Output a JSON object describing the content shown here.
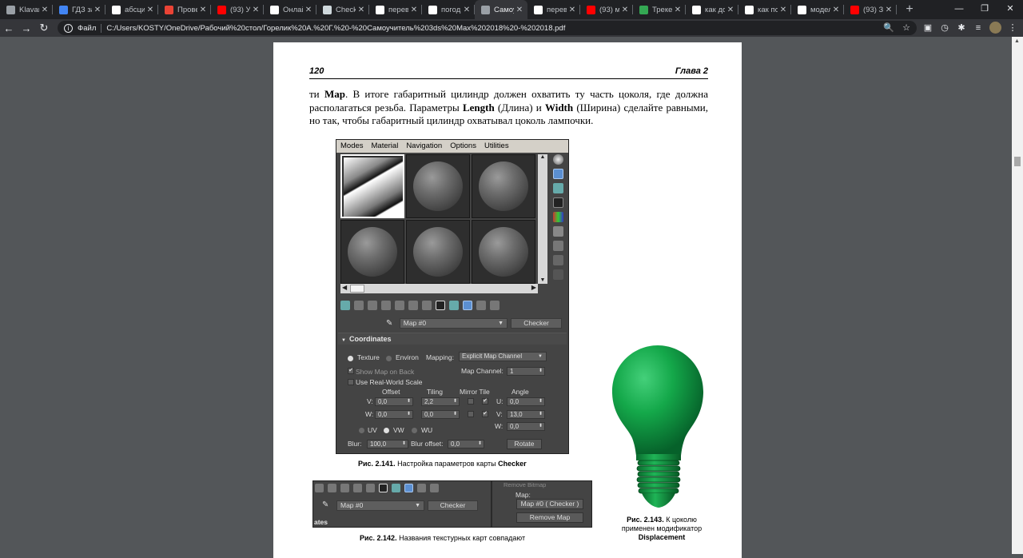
{
  "browser": {
    "tabs": [
      {
        "title": "Klavar",
        "color": "#9aa0a6"
      },
      {
        "title": "ГДЗ за",
        "color": "#4285f4"
      },
      {
        "title": "абсцис",
        "color": "#ffffff"
      },
      {
        "title": "Провер",
        "color": "#ea4335"
      },
      {
        "title": "(93) Ур",
        "color": "#ff0000"
      },
      {
        "title": "Онлай",
        "color": "#ffffff"
      },
      {
        "title": "Checkl",
        "color": "#cfd8dc"
      },
      {
        "title": "перев",
        "color": "#ffffff"
      },
      {
        "title": "погод",
        "color": "#ffffff"
      },
      {
        "title": "Самоу",
        "color": "#9aa0a6",
        "active": true
      },
      {
        "title": "перев",
        "color": "#ffffff"
      },
      {
        "title": "(93) м",
        "color": "#ff0000"
      },
      {
        "title": "Треке",
        "color": "#34a853"
      },
      {
        "title": "как до",
        "color": "#ffffff"
      },
      {
        "title": "как по",
        "color": "#ffffff"
      },
      {
        "title": "модел",
        "color": "#ffffff"
      },
      {
        "title": "(93) Зі",
        "color": "#ff0000"
      }
    ],
    "new_tab": "+",
    "window_controls": [
      "—",
      "❐",
      "✕"
    ],
    "nav": {
      "back": "←",
      "forward": "→",
      "reload": "↻"
    },
    "address": {
      "info": "i",
      "scheme_label": "Файл",
      "url": "C:/Users/KOSTY/OneDrive/Рабочий%20стол/Горелик%20А.%20Г.%20-%20Самоучитель%203ds%20Max%202018%20-%202018.pdf",
      "zoom_icon": "🔍",
      "star_icon": "☆"
    }
  },
  "page": {
    "number": "120",
    "chapter": "Глава 2",
    "paragraph": {
      "p1": "ти ",
      "b1": "Map",
      "p2": ". В итоге габаритный цилиндр должен охватить ту часть цоколя, где должна располагаться резьба. Параметры ",
      "b2": "Length",
      "p3": " (Длина) и ",
      "b3": "Width",
      "p4": " (Ширина) сделайте равными, но так, чтобы габаритный цилиндр охватывал цоколь лампочки."
    }
  },
  "editor": {
    "menu": [
      "Modes",
      "Material",
      "Navigation",
      "Options",
      "Utilities"
    ],
    "map_name": "Map #0",
    "map_type": "Checker",
    "rollout_title": "Coordinates",
    "texture_label": "Texture",
    "environ_label": "Environ",
    "mapping_label": "Mapping:",
    "mapping_value": "Explicit Map Channel",
    "show_map_on_back": "Show Map on Back",
    "map_channel_label": "Map Channel:",
    "map_channel_value": "1",
    "use_real_world": "Use Real-World Scale",
    "col_offset": "Offset",
    "col_tiling": "Tiling",
    "col_mirror_tile": "Mirror Tile",
    "col_angle": "Angle",
    "u_label": "V:",
    "v_label": "W:",
    "offset_u": "0,0",
    "offset_v": "0,0",
    "tiling_u": "2,2",
    "tiling_v": "0,0",
    "angle_u_label": "U:",
    "angle_u": "0,0",
    "angle_v_label": "V:",
    "angle_v": "13,0",
    "angle_w_label": "W:",
    "angle_w": "0,0",
    "uv": "UV",
    "vw": "VW",
    "wu": "WU",
    "blur_label": "Blur:",
    "blur_value": "100,0",
    "blur_offset_label": "Blur offset:",
    "blur_offset_value": "0,0",
    "rotate_label": "Rotate",
    "check_mark": "✔"
  },
  "captions": {
    "fig141_num": "Рис. 2.141.",
    "fig141_text": " Настройка параметров карты ",
    "fig141_bold": "Checker",
    "fig142_num": "Рис. 2.142.",
    "fig142_text": " Названия текстурных карт совпадают",
    "fig143_num": "Рис. 2.143.",
    "fig143_line1": " К цоколю",
    "fig143_line2": "применен модификатор",
    "fig143_bold": "Displacement"
  },
  "fig142": {
    "map_name": "Map #0",
    "map_type": "Checker",
    "rollout_partial": "ates",
    "remove_bitmap": "Remove Bitmap",
    "map_label": "Map:",
    "map_value": "Map #0  ( Checker )",
    "remove_map": "Remove Map"
  }
}
